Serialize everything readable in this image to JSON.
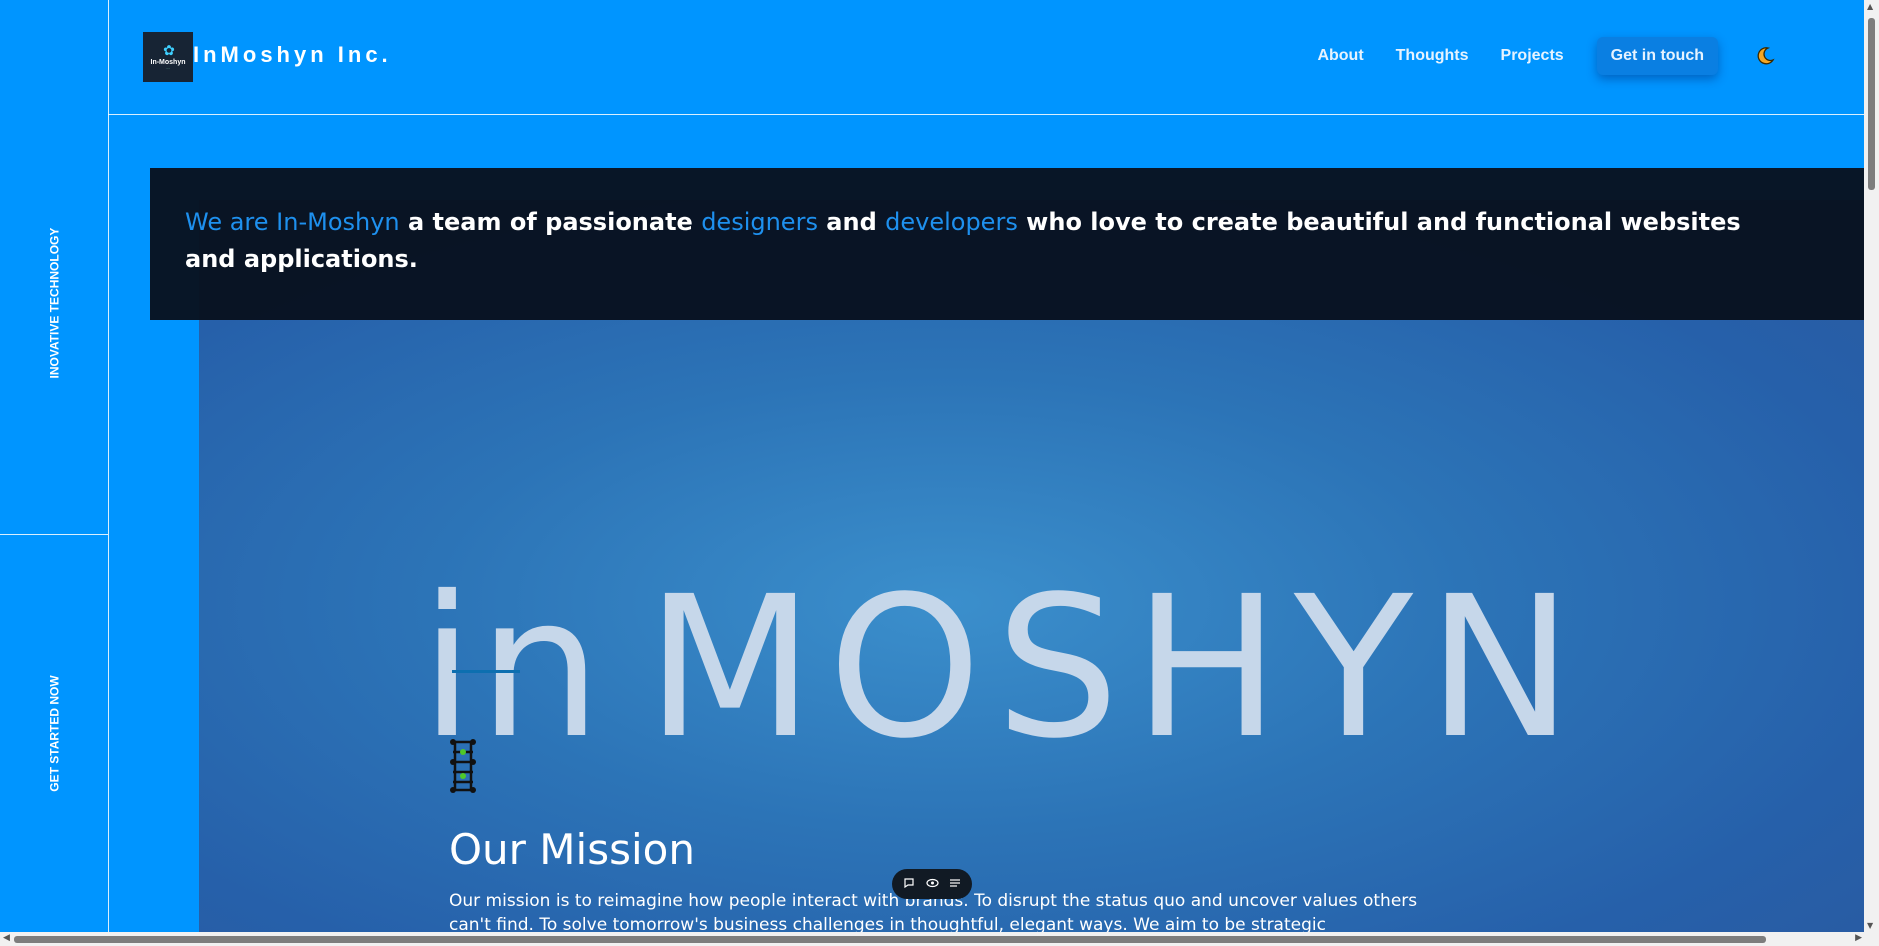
{
  "rail": {
    "top_text": "INOVATIVE TECHNOLOGY",
    "bottom_text": "GET STARTED NOW"
  },
  "header": {
    "logo_text": "In-Moshyn",
    "brand": "InMoshyn Inc.",
    "nav": {
      "about": "About",
      "thoughts": "Thoughts",
      "projects": "Projects"
    },
    "cta": "Get in touch",
    "theme_icon": "moon-icon"
  },
  "banner": {
    "part1": "We are In-Moshyn",
    "part2": " a team of passionate ",
    "part3": "designers",
    "part4": " and ",
    "part5": "developers",
    "part6": " who love to create beautiful and functional websites and applications."
  },
  "hero": {
    "logo_in": "in",
    "logo_rest": "MOSHYN"
  },
  "mission": {
    "title": "Our Mission",
    "text": "Our mission is to reimagine how people interact with brands. To disrupt the status quo and uncover values others can't find. To solve tomorrow's business challenges in thoughtful, elegant ways. We aim to be strategic"
  },
  "toolbar": {
    "icons": [
      "comment-icon",
      "eye-icon",
      "list-icon"
    ]
  },
  "colors": {
    "background": "#0095ff",
    "banner_bg": "#08121f",
    "highlight": "#1e90ee",
    "cta_bg": "#0a7fe2",
    "hero_blue": "#2c74b7"
  }
}
